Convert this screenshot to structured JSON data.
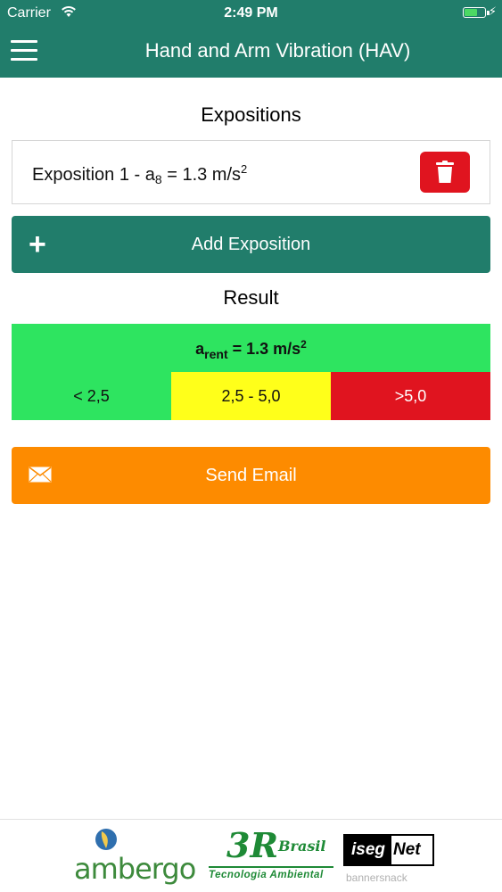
{
  "status_bar": {
    "carrier": "Carrier",
    "time": "2:49 PM"
  },
  "nav": {
    "title": "Hand and Arm Vibration (HAV)"
  },
  "expositions": {
    "heading": "Expositions",
    "items": [
      {
        "name": "Exposition 1 - a",
        "subscript": "8",
        "value": " = 1.3 m/s",
        "superscript": "2"
      }
    ],
    "add_label": "Add Exposition"
  },
  "result": {
    "heading": "Result",
    "symbol": "a",
    "subscript": "rent",
    "value": " = 1.3 m/s",
    "superscript": "2",
    "ranges": [
      {
        "label": "< 2,5",
        "color": "#2ee460"
      },
      {
        "label": "2,5 - 5,0",
        "color": "#ffff1a"
      },
      {
        "label": ">5,0",
        "color": "#e0141f"
      }
    ]
  },
  "actions": {
    "send_email_label": "Send Email"
  },
  "footer": {
    "logos": {
      "ambergo": "ambergo",
      "three_r_mark": "3R",
      "three_r_brasil": "Brasil",
      "three_r_tagline": "Tecnologia Ambiental",
      "iseg": "iseg",
      "net": "Net"
    },
    "bannersnack": "bannersnack"
  },
  "colors": {
    "primary": "#217d6b",
    "danger": "#e0141f",
    "email": "#fd8b00",
    "result_green": "#2ee460",
    "result_yellow": "#ffff1a"
  }
}
